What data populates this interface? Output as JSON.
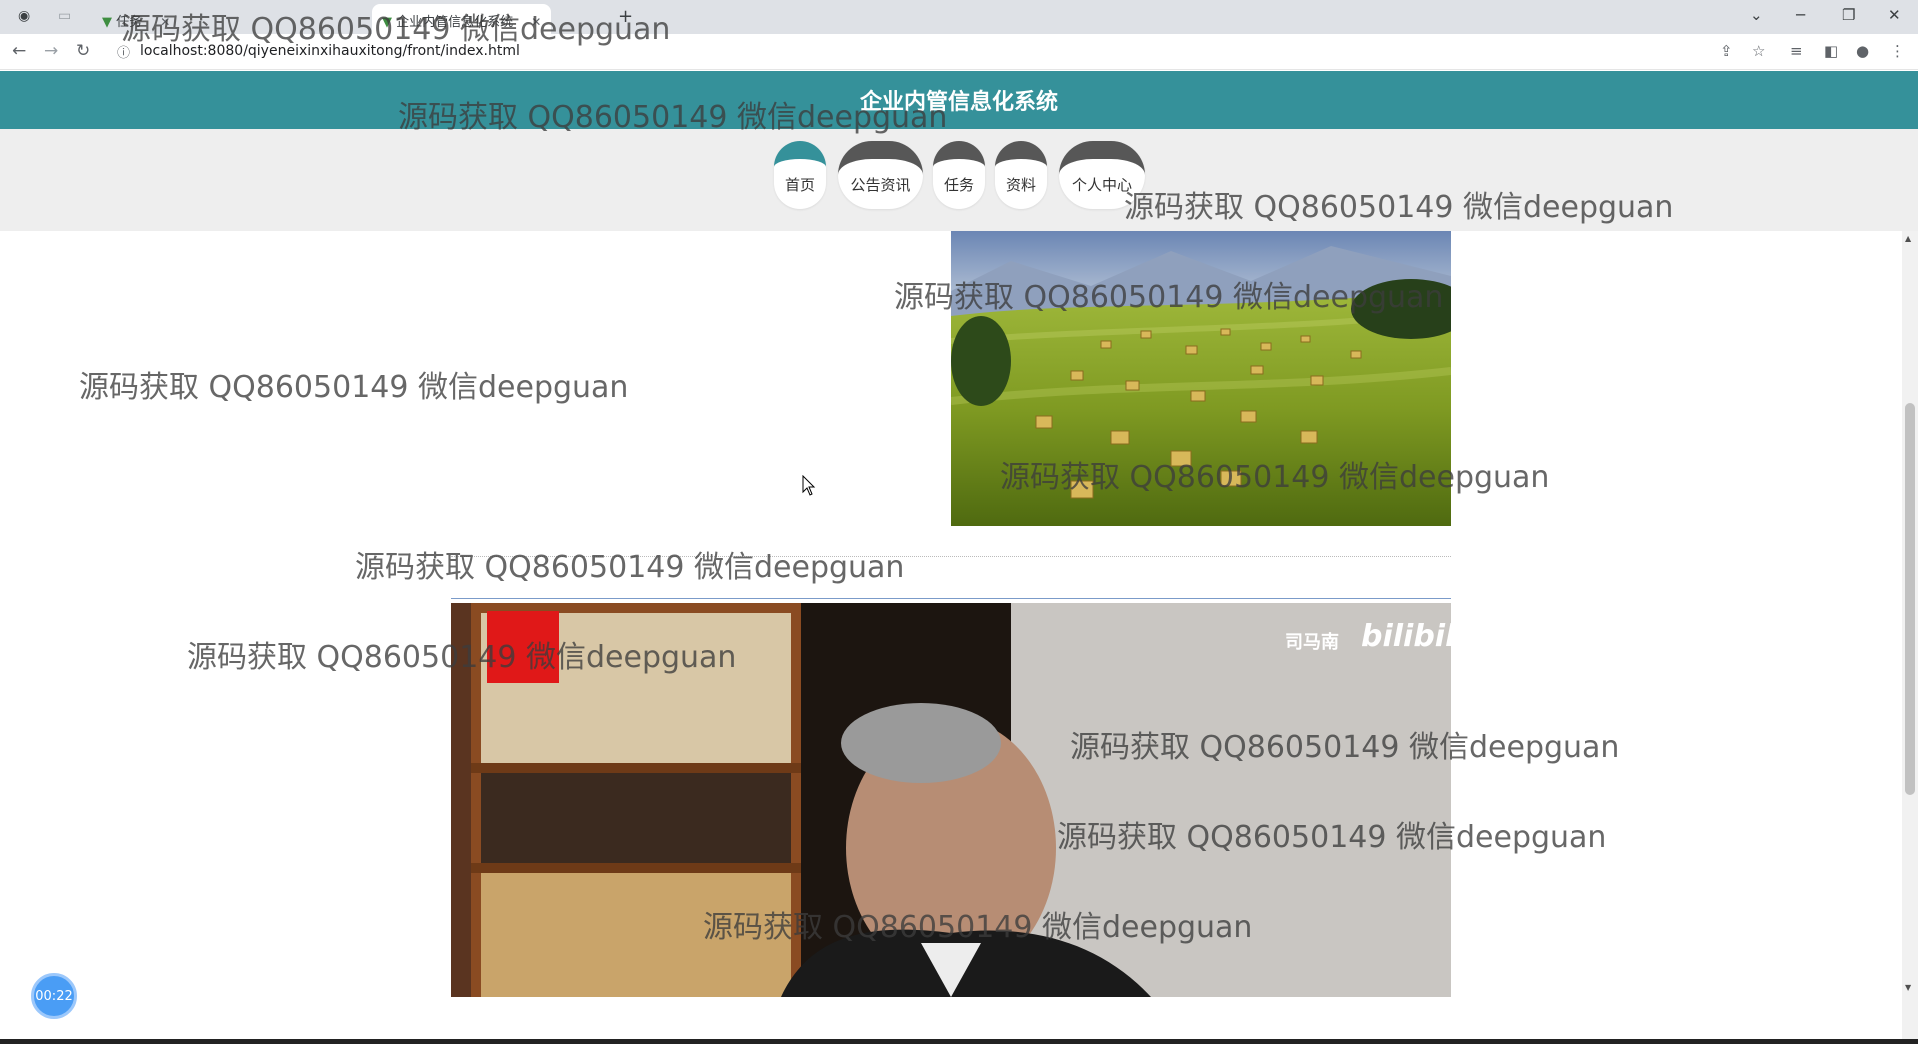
{
  "browser": {
    "tab1_title": "任务",
    "tab2_title": "企业内管信息化系统",
    "new_tab": "+",
    "url": "localhost:8080/qiyeneixinxihauxitong/front/index.html"
  },
  "site": {
    "title": "企业内管信息化系统",
    "nav": [
      "首页",
      "公告资讯",
      "任务",
      "资料",
      "个人中心"
    ]
  },
  "video": {
    "channel": "司马南",
    "logo": "bilibili"
  },
  "timer": "00:22",
  "watermark": "源码获取 QQ86050149 微信deepguan"
}
